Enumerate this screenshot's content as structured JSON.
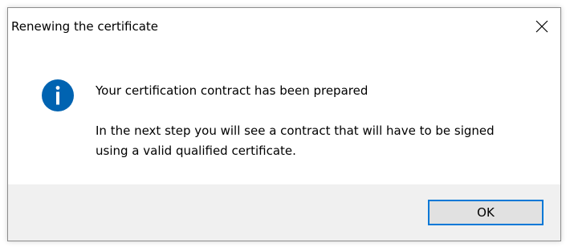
{
  "window": {
    "title": "Renewing the certificate"
  },
  "dialog": {
    "icon": "information-icon",
    "main_instruction": "Your certification contract has been prepared",
    "content_text": "In the next step you will see a contract that will have to be signed using a valid qualified certificate."
  },
  "buttons": {
    "ok_label": "OK"
  },
  "colors": {
    "accent": "#0078d7",
    "footer_background": "#f0f0f0",
    "button_face": "#e1e1e1"
  }
}
